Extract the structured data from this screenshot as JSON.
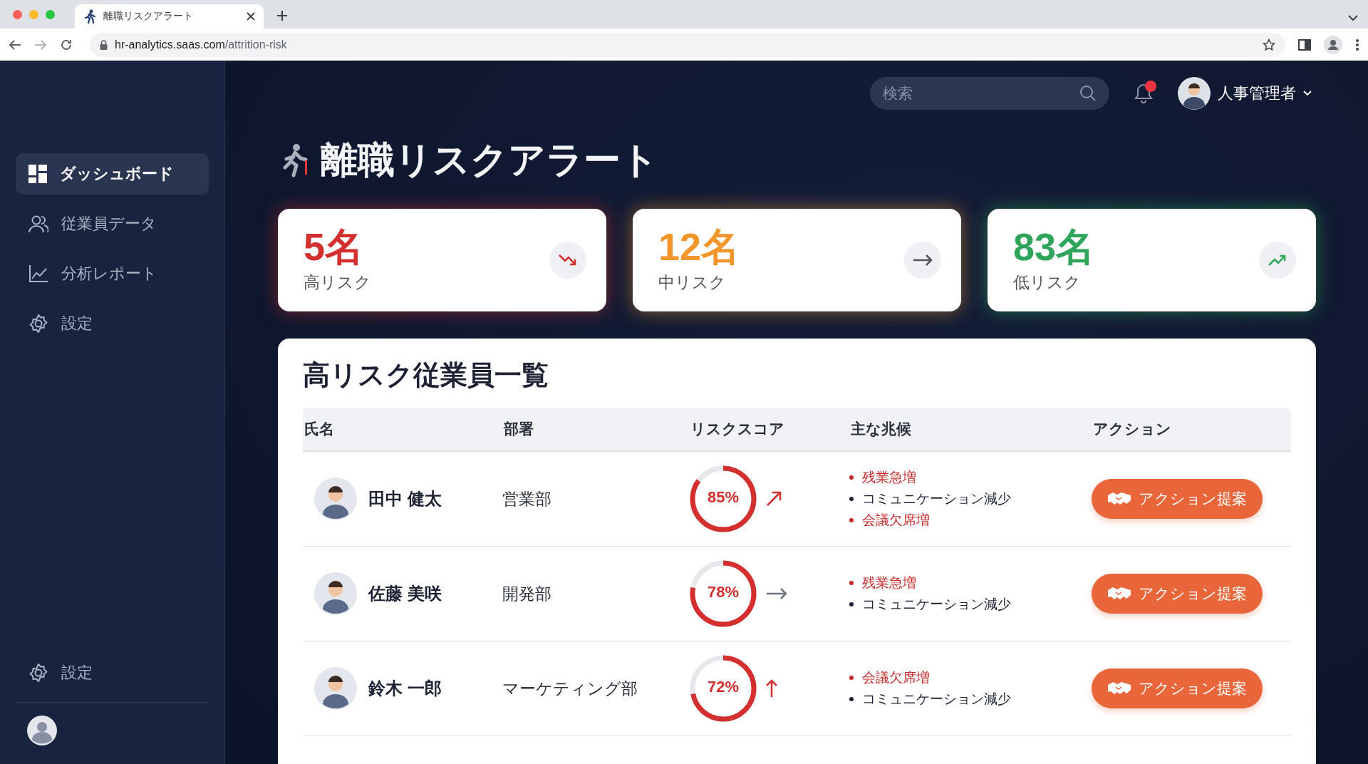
{
  "browser": {
    "tab_title": "離職リスクアラート",
    "url_host": "hr-analytics.saas.com",
    "url_path": "/attrition-risk"
  },
  "sidebar": {
    "items": [
      {
        "label": "ダッシュボード",
        "kind": "dashboard",
        "selected": true
      },
      {
        "label": "従業員データ",
        "kind": "people",
        "selected": false
      },
      {
        "label": "分析レポート",
        "kind": "chart",
        "selected": false
      },
      {
        "label": "設定",
        "kind": "settings",
        "selected": false
      }
    ],
    "footer_item": {
      "label": "設定",
      "kind": "settings"
    }
  },
  "header": {
    "search": {
      "placeholder": "検索"
    },
    "notifications": {
      "unread": true
    },
    "user": {
      "name": "人事管理者"
    }
  },
  "title": "離職リスクアラート",
  "summary_cards": [
    {
      "value": "5名",
      "label": "高リスク",
      "color": "#d32f2f",
      "kind": "down"
    },
    {
      "value": "12名",
      "label": "中リスク",
      "color": "#f2952b",
      "kind": "flat"
    },
    {
      "value": "83名",
      "label": "低リスク",
      "color": "#2ea55a",
      "kind": "up"
    }
  ],
  "table": {
    "title": "高リスク従業員一覧",
    "columns": [
      "氏名",
      "部署",
      "リスクスコア",
      "主な兆候",
      "アクション"
    ],
    "rows": [
      {
        "name": "田中 健太",
        "department": "営業部",
        "score": "85%",
        "level": 0.85,
        "kind": "rising",
        "signs": [
          {
            "text": "残業急増",
            "alert": true
          },
          {
            "text": "コミュニケーション減少",
            "alert": false
          },
          {
            "text": "会議欠席増",
            "alert": true
          }
        ],
        "action": "アクション提案"
      },
      {
        "name": "佐藤 美咲",
        "department": "開発部",
        "score": "78%",
        "level": 0.78,
        "kind": "flat",
        "signs": [
          {
            "text": "残業急増",
            "alert": true
          },
          {
            "text": "コミュニケーション減少",
            "alert": false
          }
        ],
        "action": "アクション提案"
      },
      {
        "name": "鈴木 一郎",
        "department": "マーケティング部",
        "score": "72%",
        "level": 0.72,
        "kind": "up",
        "signs": [
          {
            "text": "会議欠席増",
            "alert": true
          },
          {
            "text": "コミュニケーション減少",
            "alert": false
          }
        ],
        "action": "アクション提案"
      }
    ]
  }
}
